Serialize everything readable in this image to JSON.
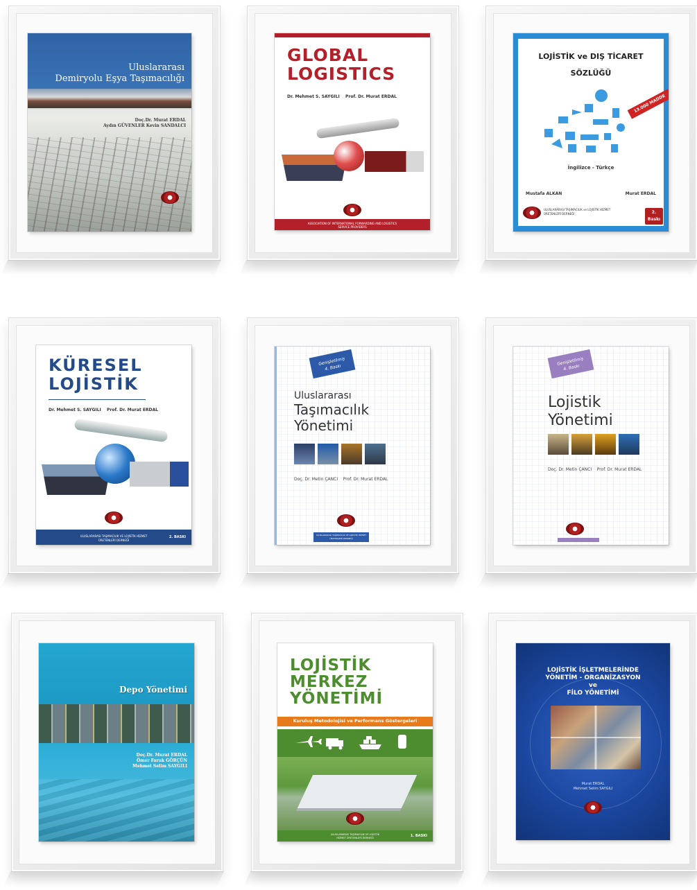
{
  "colors": {
    "frame": "#ececec",
    "red": "#b3202a",
    "blue": "#244a8a",
    "cyan": "#23a6cf",
    "green": "#4d8c2f",
    "orange": "#e77a1b",
    "navy": "#1b47a0"
  },
  "books": [
    {
      "title_line1": "Uluslararası",
      "title_line2": "Demiryolu Eşya Taşımacılığı",
      "authors_line1": "Doç.Dr. Murat ERDAL",
      "authors_line2": "Aydın GÜVENLER  Kevin SANDALCI"
    },
    {
      "title_line1": "GLOBAL",
      "title_line2": "LOGISTICS",
      "author1": "Dr. Mehmet S. SAYGILI",
      "author2": "Prof. Dr. Murat ERDAL",
      "footer": "ASSOCIATION OF INTERNATIONAL FORWARDING AND LOGISTICS SERVICE PROVIDERS"
    },
    {
      "title_line1": "LOJİSTİK ve DIŞ TİCARET",
      "title_line2": "SÖZLÜĞÜ",
      "badge": "13.000 MADDE",
      "subtitle": "İngilizce - Türkçe",
      "author1": "Mustafa ALKAN",
      "author2": "Murat ERDAL",
      "publisher": "ULUSLARARASI TAŞIMACILIK ve LOJİSTİK HİZMET ÜRETENLERİ DERNEĞİ",
      "edition_line1": "2.",
      "edition_line2": "Baskı"
    },
    {
      "title_line1": "KÜRESEL",
      "title_line2": "LOJİSTİK",
      "author1": "Dr. Mehmet S. SAYGILI",
      "author2": "Prof. Dr. Murat ERDAL",
      "publisher": "ULUSLARARASI TAŞIMACILIK VE LOJİSTİK HİZMET ÜRETENLERİ DERNEĞİ",
      "edition": "2. BASKI"
    },
    {
      "tag_line1": "Genişletilmiş",
      "tag_line2": "4. Baskı",
      "title_line1": "Uluslararası",
      "title_line2": "Taşımacılık",
      "title_line3": "Yönetimi",
      "author1": "Doç. Dr. Metin ÇANCI",
      "author2": "Prof. Dr. Murat ERDAL",
      "publisher": "ULUSLARARASI TAŞIMACILIK VE LOJİSTİK HİZMET ÜRETENLERİ DERNEĞİ"
    },
    {
      "tag_line1": "Genişletilmiş",
      "tag_line2": "4. Baskı",
      "title_line1": "Lojistik",
      "title_line2": "Yönetimi",
      "author1": "Doç. Dr. Metin ÇANCI",
      "author2": "Prof. Dr. Murat ERDAL"
    },
    {
      "title": "Depo Yönetimi",
      "authors_line1": "Doç.Dr. Murat ERDAL",
      "authors_line2": "Ömer Faruk GÖRÇÜN",
      "authors_line3": "Mehmet Selim SAYGILI"
    },
    {
      "title_line1": "LOJİSTİK",
      "title_line2": "MERKEZ",
      "title_line3": "YÖNETİMİ",
      "subtitle": "Kuruluş Metodolojisi ve Performans Göstergeleri",
      "publisher": "ULUSLARARASI TAŞIMACILIK VE LOJİSTİK HİZMET ÜRETENLERİ DERNEĞİ",
      "edition": "1. BASKI"
    },
    {
      "title_line1": "LOJİSTİK İŞLETMELERİNDE",
      "title_line2": "YÖNETİM - ORGANİZASYON",
      "title_line3": "ve",
      "title_line4": "FİLO YÖNETİMİ",
      "authors_line1": "Murat ERDAL",
      "authors_line2": "Mehmet Selim SAYGILI"
    }
  ]
}
